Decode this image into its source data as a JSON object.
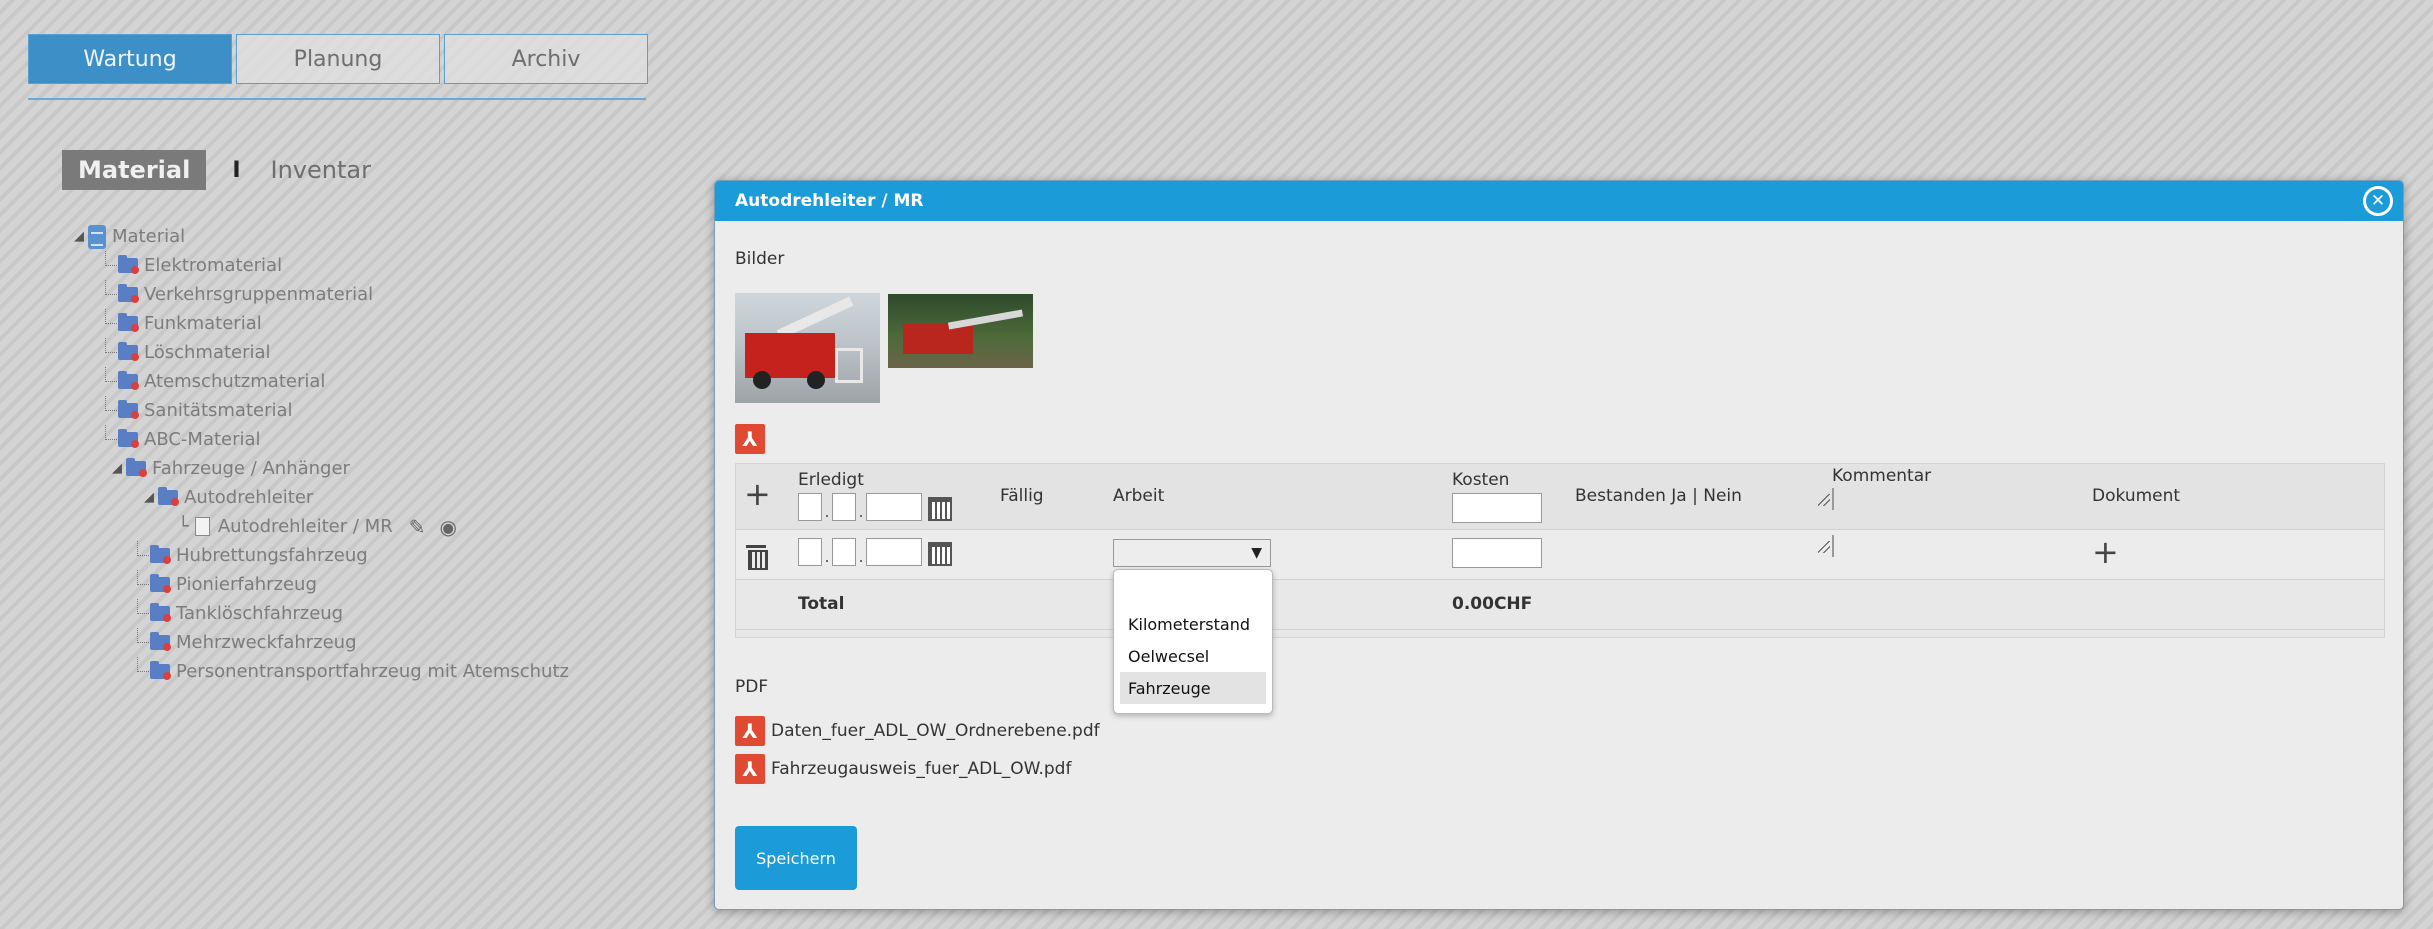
{
  "top_tabs": [
    {
      "label": "Wartung",
      "active": true
    },
    {
      "label": "Planung",
      "active": false
    },
    {
      "label": "Archiv",
      "active": false
    }
  ],
  "view_switch": {
    "material": "Material",
    "separator": "I",
    "inventar": "Inventar"
  },
  "tree": {
    "root": "Material",
    "items": [
      "Elektromaterial",
      "Verkehrsgruppenmaterial",
      "Funkmaterial",
      "Löschmaterial",
      "Atemschutzmaterial",
      "Sanitätsmaterial",
      "ABC-Material",
      "Fahrzeuge / Anhänger"
    ],
    "vehicles": [
      "Autodrehleiter",
      "Hubrettungsfahrzeug",
      "Pionierfahrzeug",
      "Tanklöschfahrzeug",
      "Mehrzweckfahrzeug",
      "Personentransportfahrzeug mit Atemschutz"
    ],
    "leaf": "Autodrehleiter / MR"
  },
  "modal": {
    "title": "Autodrehleiter / MR",
    "bilder_label": "Bilder",
    "table": {
      "headers": {
        "erledigt": "Erledigt",
        "faellig": "Fällig",
        "arbeit": "Arbeit",
        "kosten": "Kosten",
        "bestanden": "Bestanden Ja | Nein",
        "kommentar": "Kommentar",
        "dokument": "Dokument"
      },
      "date_separator": ".",
      "total_label": "Total",
      "total_value": "0.00CHF"
    },
    "dropdown_options": [
      "Kilometerstand",
      "Oelwecsel",
      "Fahrzeuge"
    ],
    "pdf_label": "PDF",
    "pdfs": [
      "Daten_fuer_ADL_OW_Ordnerebene.pdf",
      "Fahrzeugausweis_fuer_ADL_OW.pdf"
    ],
    "save_label": "Speichern"
  },
  "colors": {
    "accent": "#1b9bd7",
    "tab_active": "#3d8fc7",
    "pdf_red": "#e04a32"
  }
}
